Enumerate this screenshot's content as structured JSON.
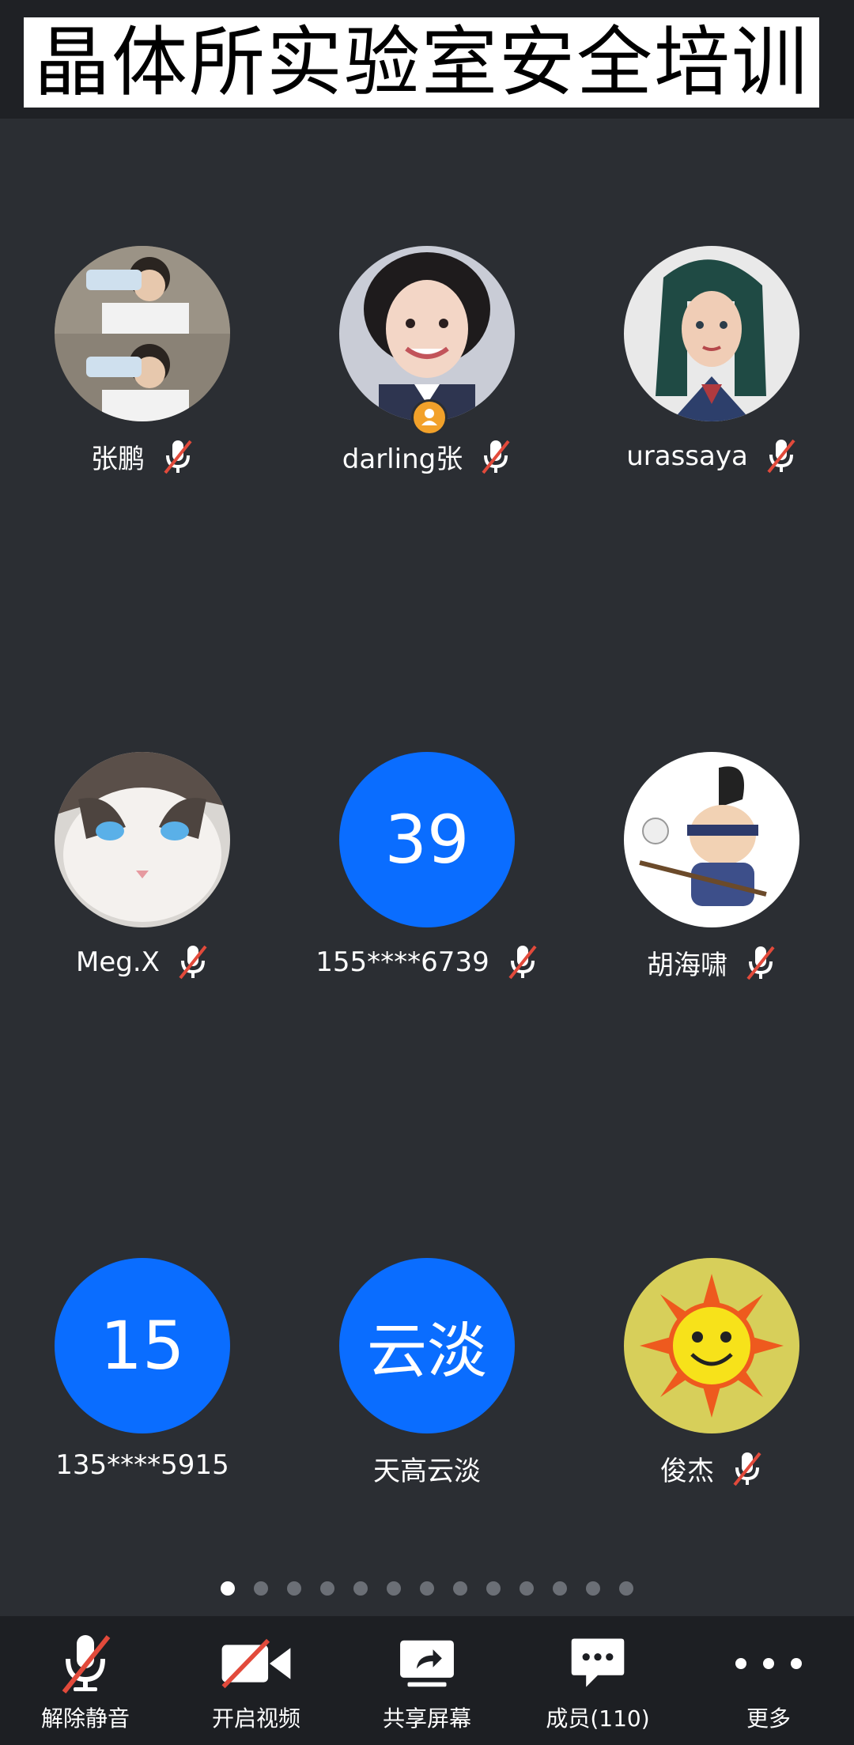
{
  "header": {
    "title": "晶体所实验室安全培训"
  },
  "participants": [
    {
      "name": "张鹏",
      "avatar_icon": "photo-avatar-boy-drinking",
      "avatar_text": "",
      "muted": true,
      "host": false
    },
    {
      "name": "darling张",
      "avatar_icon": "photo-avatar-smiling-girl",
      "avatar_text": "",
      "muted": true,
      "host": true
    },
    {
      "name": "urassaya",
      "avatar_icon": "photo-avatar-cartoon-heroine",
      "avatar_text": "",
      "muted": true,
      "host": false
    },
    {
      "name": "Meg.X",
      "avatar_icon": "photo-avatar-cat",
      "avatar_text": "",
      "muted": true,
      "host": false
    },
    {
      "name": "155****6739",
      "avatar_icon": "",
      "avatar_text": "39",
      "muted": true,
      "host": false
    },
    {
      "name": "胡海啸",
      "avatar_icon": "photo-avatar-cartoon-character",
      "avatar_text": "",
      "muted": true,
      "host": false
    },
    {
      "name": "135****5915",
      "avatar_icon": "",
      "avatar_text": "15",
      "muted": false,
      "host": false
    },
    {
      "name": "天高云淡",
      "avatar_icon": "",
      "avatar_text": "云淡",
      "muted": false,
      "host": false
    },
    {
      "name": "俊杰",
      "avatar_icon": "photo-avatar-sun",
      "avatar_text": "",
      "muted": true,
      "host": false
    }
  ],
  "pager": {
    "total_pages": 13,
    "current_page": 1
  },
  "toolbar": {
    "unmute": {
      "label": "解除静音",
      "icon": "mic-muted-icon"
    },
    "video": {
      "label": "开启视频",
      "icon": "video-off-icon"
    },
    "share": {
      "label": "共享屏幕",
      "icon": "share-screen-icon"
    },
    "members": {
      "label": "成员(110)",
      "icon": "chat-bubble-icon"
    },
    "more": {
      "label": "更多",
      "icon": "more-icon"
    }
  },
  "colors": {
    "background": "#2b2e33",
    "accent": "#0a6dff",
    "host_badge": "#f2a12a",
    "mute_slash": "#e24a3b"
  }
}
